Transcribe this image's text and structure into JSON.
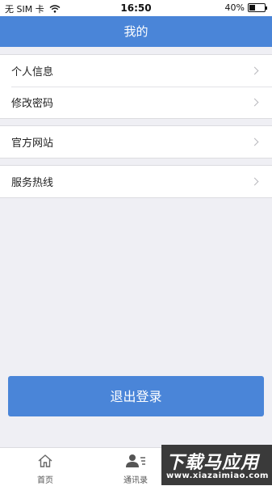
{
  "status_bar": {
    "carrier": "无 SIM 卡",
    "time": "16:50",
    "battery_text": "40%",
    "battery_level": 0.4
  },
  "nav": {
    "title": "我的"
  },
  "menu_groups": [
    {
      "items": [
        {
          "label": "个人信息"
        },
        {
          "label": "修改密码"
        }
      ]
    },
    {
      "items": [
        {
          "label": "官方网站"
        }
      ]
    },
    {
      "items": [
        {
          "label": "服务热线"
        }
      ]
    }
  ],
  "logout_label": "退出登录",
  "tab_bar": {
    "tabs": [
      {
        "label": "首页",
        "icon": "home-icon"
      },
      {
        "label": "通讯录",
        "icon": "contacts-icon"
      }
    ]
  },
  "watermark": {
    "title": "下载马应用",
    "url": "www.xiazaimiao.com"
  },
  "colors": {
    "accent": "#4a85d8",
    "background": "#efeff4"
  }
}
